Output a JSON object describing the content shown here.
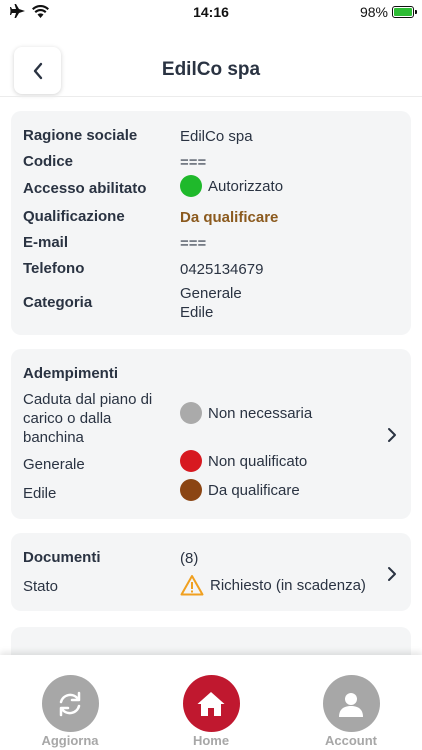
{
  "status_bar": {
    "time": "14:16",
    "battery": "98%",
    "battery_level": 0.98
  },
  "header": {
    "title": "EdilCo spa"
  },
  "info": {
    "rows": [
      {
        "label": "Ragione sociale",
        "value": "EdilCo spa"
      },
      {
        "label": "Codice",
        "value": "==="
      },
      {
        "label": "Accesso abilitato",
        "value": "Autorizzato",
        "dot_color": "#1fb92b"
      },
      {
        "label": "Qualificazione",
        "value": "Da qualificare",
        "value_color": "#8b5a1e"
      },
      {
        "label": "E-mail",
        "value": "==="
      },
      {
        "label": "Telefono",
        "value": "0425134679"
      },
      {
        "label": "Categoria",
        "value_lines": [
          "Generale",
          "Edile"
        ]
      }
    ]
  },
  "adempimenti": {
    "title": "Adempimenti",
    "rows": [
      {
        "label_lines": [
          "Caduta dal piano di",
          "carico o dalla",
          "banchina"
        ],
        "value": "Non necessaria",
        "dot_color": "#aaaaaa"
      },
      {
        "label": "Generale",
        "value": "Non qualificato",
        "dot_color": "#d71920"
      },
      {
        "label": "Edile",
        "value": "Da qualificare",
        "dot_color": "#8b4513"
      }
    ]
  },
  "documenti": {
    "title": "Documenti",
    "count": "(8)",
    "stato_label": "Stato",
    "stato_value": "Richiesto (in scadenza)",
    "warning_color": "#f0a020"
  },
  "tabbar": {
    "items": [
      {
        "label": "Aggiorna",
        "icon": "refresh-icon",
        "color": "#a7a7a7"
      },
      {
        "label": "Home",
        "icon": "home-icon",
        "color": "#c0182f"
      },
      {
        "label": "Account",
        "icon": "user-icon",
        "color": "#a7a7a7"
      }
    ]
  }
}
